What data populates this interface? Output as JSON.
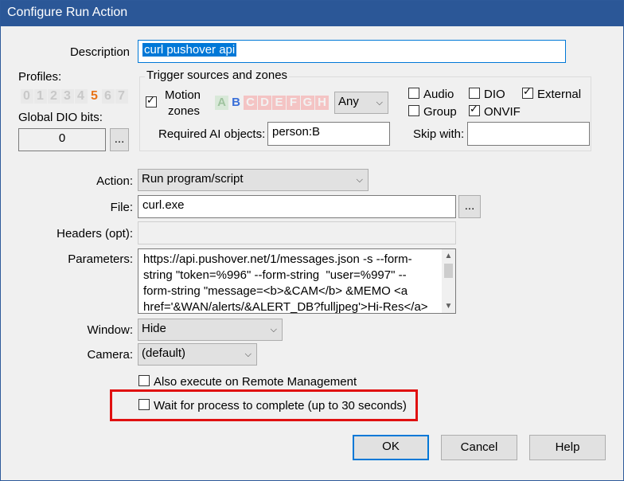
{
  "window": {
    "title": "Configure Run Action"
  },
  "description": {
    "label": "Description",
    "value": "curl pushover api"
  },
  "profiles": {
    "label": "Profiles:",
    "digits": [
      "0",
      "1",
      "2",
      "3",
      "4",
      "5",
      "6",
      "7"
    ],
    "active": "5"
  },
  "global_dio": {
    "label": "Global DIO bits:",
    "value": "0",
    "browse": "..."
  },
  "trigger": {
    "group_title": "Trigger sources and zones",
    "motion_label_1": "Motion",
    "motion_label_2": "zones",
    "zones": [
      "A",
      "B",
      "C",
      "D",
      "E",
      "F",
      "G",
      "H"
    ],
    "zone_colors": {
      "A": "#c6ddc6",
      "B": "#3a6fd8",
      "C": "#f0b0b0",
      "D": "#f0b0b0",
      "E": "#f0b0b0",
      "F": "#f0b0b0",
      "G": "#f0b0b0",
      "H": "#f0b0b0"
    },
    "any_value": "Any",
    "required_ai_label": "Required AI objects:",
    "required_ai_value": "person:B",
    "audio_label": "Audio",
    "dio_label": "DIO",
    "external_label": "External",
    "group_label": "Group",
    "onvif_label": "ONVIF",
    "skip_with_label": "Skip with:",
    "skip_with_value": ""
  },
  "action": {
    "label": "Action:",
    "value": "Run program/script"
  },
  "file": {
    "label": "File:",
    "value": "curl.exe",
    "browse": "..."
  },
  "headers": {
    "label": "Headers (opt):",
    "value": ""
  },
  "parameters": {
    "label": "Parameters:",
    "lines": [
      "https://api.pushover.net/1/messages.json -s --form-",
      "string \"token=%996\" --form-string  \"user=%997\" --",
      "form-string \"message=<b>&CAM</b> &MEMO <a",
      "href='&WAN/alerts/&ALERT_DB?fulljpeg'>Hi-Res</a>"
    ]
  },
  "window_mode": {
    "label": "Window:",
    "value": "Hide"
  },
  "camera": {
    "label": "Camera:",
    "value": "(default)"
  },
  "also_execute": {
    "label": "Also execute on Remote Management",
    "checked": false
  },
  "wait_process": {
    "label": "Wait for process to complete (up to 30 seconds)",
    "checked": false
  },
  "buttons": {
    "ok": "OK",
    "cancel": "Cancel",
    "help": "Help"
  },
  "colors": {
    "titlebar": "#2b5797",
    "highlight_box": "#e01010",
    "profile_active": "#e8741a"
  }
}
